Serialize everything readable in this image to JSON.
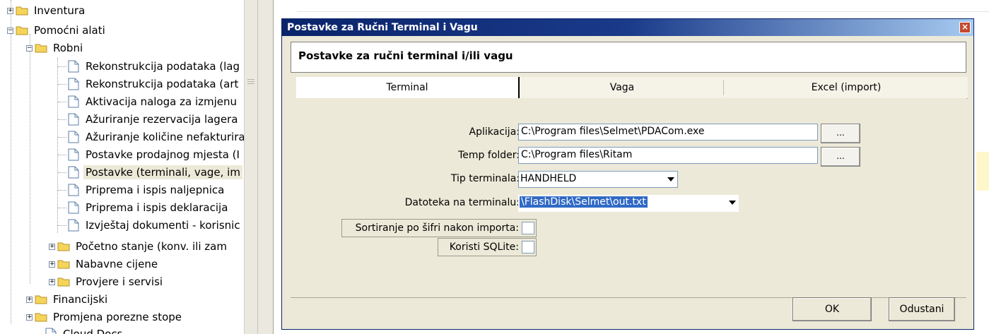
{
  "tree": {
    "items": [
      {
        "label": "Inventura"
      },
      {
        "label": "Pomoćni alati"
      },
      {
        "label": "Robni"
      },
      {
        "label": "Rekonstrukcija podataka (lag"
      },
      {
        "label": "Rekonstrukcija podataka (art"
      },
      {
        "label": "Aktivacija naloga za izmjenu"
      },
      {
        "label": "Ažuriranje rezervacija lagera"
      },
      {
        "label": "Ažuriranje količine nefakturira"
      },
      {
        "label": "Postavke prodajnog mjesta (I"
      },
      {
        "label": "Postavke (terminali, vage, im"
      },
      {
        "label": "Priprema i ispis naljepnica"
      },
      {
        "label": "Priprema i ispis deklaracija"
      },
      {
        "label": "Izvještaj dokumenti - korisnic"
      },
      {
        "label": "Početno stanje (konv. ili zam"
      },
      {
        "label": "Nabavne cijene"
      },
      {
        "label": "Provjere i servisi"
      },
      {
        "label": "Financijski"
      },
      {
        "label": "Promjena porezne stope"
      },
      {
        "label": "Cloud Docs"
      }
    ]
  },
  "dialog": {
    "title": "Postavke za Ručni Terminal i Vagu",
    "close_label": "×",
    "header": "Postavke za ručni terminal i/ili vagu",
    "tabs": [
      {
        "label": "Terminal",
        "active": true
      },
      {
        "label": "Vaga",
        "active": false
      },
      {
        "label": "Excel (import)",
        "active": false
      }
    ],
    "form": {
      "aplikacija_label": "Aplikacija:",
      "aplikacija_value": "C:\\Program files\\Selmet\\PDACom.exe",
      "temp_label": "Temp folder:",
      "temp_value": "C:\\Program files\\Ritam",
      "browse_label": "...",
      "tip_label": "Tip terminala:",
      "tip_value": "HANDHELD",
      "datoteka_label": "Datoteka na terminalu:",
      "datoteka_value": "\\FlashDisk\\Selmet\\out.txt",
      "sortiranje_label": "Sortiranje po šifri nakon importa:",
      "sortiranje_checked": false,
      "sqlite_label": "Koristi SQLite:",
      "sqlite_checked": false
    },
    "ok_label": "OK",
    "cancel_label": "Odustani"
  },
  "colors": {
    "title_bar_start": "#0a246a",
    "title_bar_end": "#a6caf0",
    "dialog_bg": "#ece9d8",
    "selection": "#316ac5",
    "folder": "#f5d45a"
  }
}
